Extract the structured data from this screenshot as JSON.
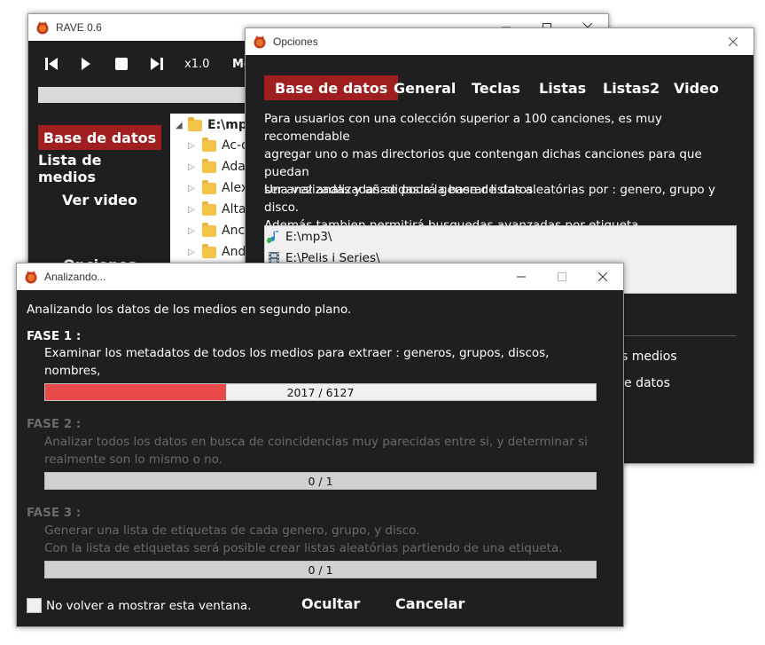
{
  "rave": {
    "title": "RAVE 0.6",
    "speed": "x1.0",
    "me_label": "Me",
    "nav": [
      {
        "label": "Base de datos",
        "active": true
      },
      {
        "label": "Lista de medios",
        "active": false
      },
      {
        "label": "Ver video",
        "active": false
      },
      {
        "label": "Opciones",
        "active": false
      }
    ],
    "tree": {
      "root": "E:\\mp3",
      "items": [
        "Ac-dc",
        "Adagio",
        "Alex",
        "Altar",
        "Ancient",
        "Andromeda"
      ]
    }
  },
  "opciones": {
    "title": "Opciones",
    "tabs": [
      {
        "label": "Base de datos",
        "active": true
      },
      {
        "label": "General",
        "active": false
      },
      {
        "label": "Teclas",
        "active": false
      },
      {
        "label": "Listas",
        "active": false
      },
      {
        "label": "Listas2",
        "active": false
      },
      {
        "label": "Video",
        "active": false
      }
    ],
    "para1": [
      "Para usuarios con una colección superior a 100 canciones, es muy recomendable",
      "agregar uno o mas directorios que contengan dichas canciones para que puedan",
      "ser analizadas y añadidas a la base de datos."
    ],
    "para2": [
      "Una vez analizadas se podrá generar listas aleatórias por : genero, grupo y disco.",
      "Además tambien permitirá busquedas avanzadas por etiqueta."
    ],
    "dirs": [
      "E:\\mp3\\",
      "E:\\Pelis i Series\\"
    ],
    "partial_links": [
      "s medios",
      "e datos"
    ]
  },
  "analizando": {
    "title": "Analizando...",
    "intro": "Analizando los datos de los medios en segundo plano.",
    "phases": [
      {
        "title": "FASE 1 :",
        "lines": [
          "Examinar los metadatos de todos los medios para extraer : generos, grupos, discos, nombres,",
          "pistas, y tiempos."
        ],
        "progress_label": "2017 / 6127",
        "progress": 0.329,
        "active": true
      },
      {
        "title": "FASE 2 :",
        "lines": [
          "Analizar todos los datos en busca de coincidencias muy parecidas entre si, y determinar si",
          "realmente son lo mismo o no."
        ],
        "progress_label": "0 / 1",
        "progress": 0,
        "active": false
      },
      {
        "title": "FASE 3 :",
        "lines": [
          "Generar una lista de etiquetas de cada genero, grupo, y disco.",
          "Con la lista de etiquetas será posible crear listas aleatórias partiendo de una etiqueta."
        ],
        "progress_label": "0 / 1",
        "progress": 0,
        "active": false
      }
    ],
    "checkbox_label": "No volver a mostrar esta ventana.",
    "hide_button": "Ocultar",
    "cancel_button": "Cancelar"
  },
  "colors": {
    "accent": "#a11e1e",
    "progress_fill": "#e84a4a",
    "background": "#1f1f1f"
  }
}
